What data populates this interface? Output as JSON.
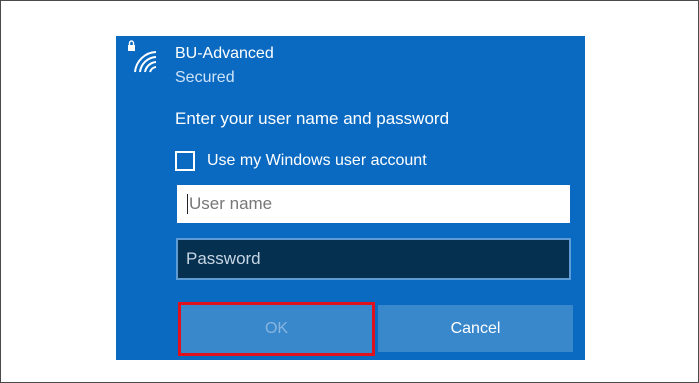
{
  "network": {
    "name": "BU-Advanced",
    "status": "Secured",
    "icon": "secured-wifi-icon"
  },
  "prompt": "Enter your user name and password",
  "windows_account": {
    "label": "Use my Windows user account",
    "checked": false
  },
  "username": {
    "placeholder": "User name",
    "value": ""
  },
  "password": {
    "placeholder": "Password",
    "value": ""
  },
  "buttons": {
    "ok_label": "OK",
    "ok_enabled": false,
    "cancel_label": "Cancel"
  },
  "colors": {
    "panel": "#0a6ac2",
    "button": "#3a88cc",
    "highlight": "#e0101c"
  }
}
